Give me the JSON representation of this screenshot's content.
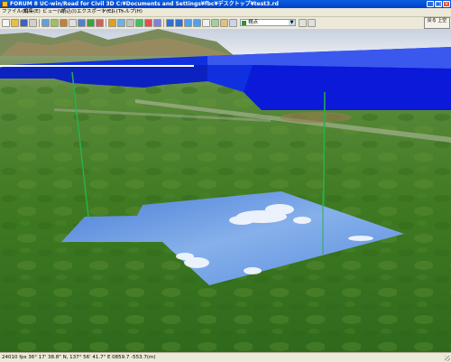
{
  "window": {
    "title": "FORUM 8 UC-win/Road for Civil 3D C:¥Documents and Settings¥fbc¥デスクトップ¥test3.rd",
    "minimize": "_",
    "maximize": "□",
    "close": "×"
  },
  "menu": [
    "ファイル(F)",
    "編集(E)",
    "ビュー(V)",
    "読込(I)",
    "エクスポート(E)",
    "ツール(T)",
    "ヘルプ(H)"
  ],
  "toolbar": {
    "view_select": "視点",
    "side_button": "戻る 上空"
  },
  "status": {
    "text": "24010 fps   36° 17' 38.8\" N, 137° 56' 41.7\" E   0859.7 -553.7(m)"
  },
  "colors": {
    "ground": "#3f7a24",
    "tunnel": "#1030e0",
    "sky_panel": "#6fa0e0",
    "pole": "#2ab04a"
  }
}
